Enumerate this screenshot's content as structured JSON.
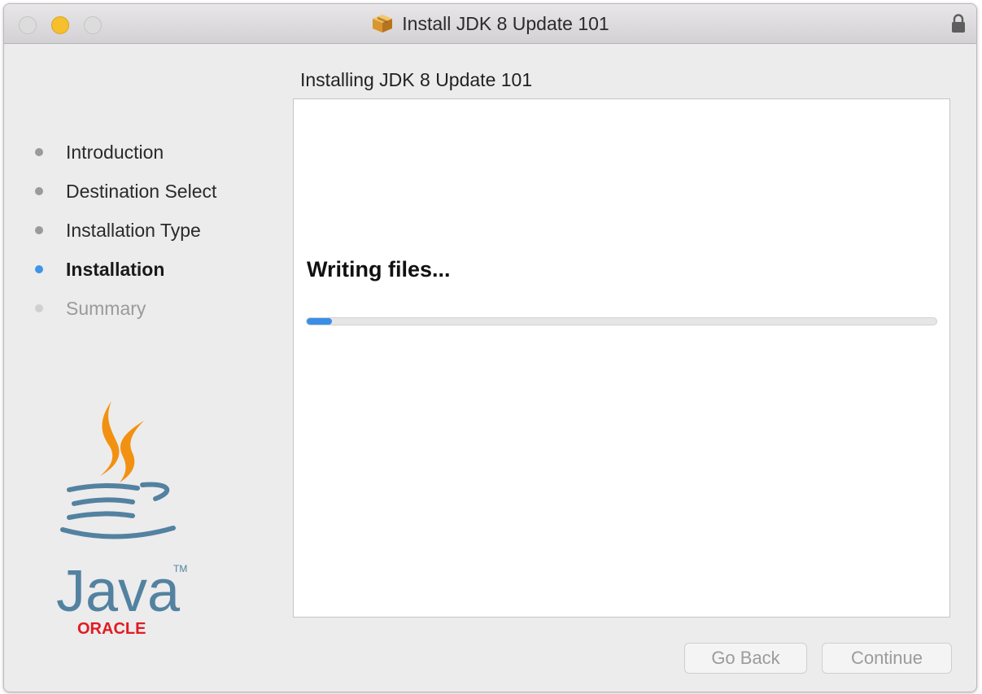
{
  "window": {
    "title": "Install JDK 8 Update 101"
  },
  "sidebar": {
    "steps": [
      {
        "label": "Introduction",
        "state": "done"
      },
      {
        "label": "Destination Select",
        "state": "done"
      },
      {
        "label": "Installation Type",
        "state": "done"
      },
      {
        "label": "Installation",
        "state": "active"
      },
      {
        "label": "Summary",
        "state": "future"
      }
    ],
    "logo": {
      "wordmark": "Java",
      "vendor": "ORACLE",
      "trademark": "TM"
    }
  },
  "main": {
    "pane_title": "Installing JDK 8 Update 101",
    "status": "Writing files...",
    "progress_percent": 4
  },
  "footer": {
    "back_label": "Go Back",
    "continue_label": "Continue"
  },
  "colors": {
    "accent": "#3f95e8",
    "progress": "#3a8ee6",
    "java_orange": "#f29111",
    "java_blue": "#5382a1",
    "oracle_red": "#e11b22"
  },
  "icons": [
    "package-icon",
    "lock-icon",
    "java-logo"
  ]
}
